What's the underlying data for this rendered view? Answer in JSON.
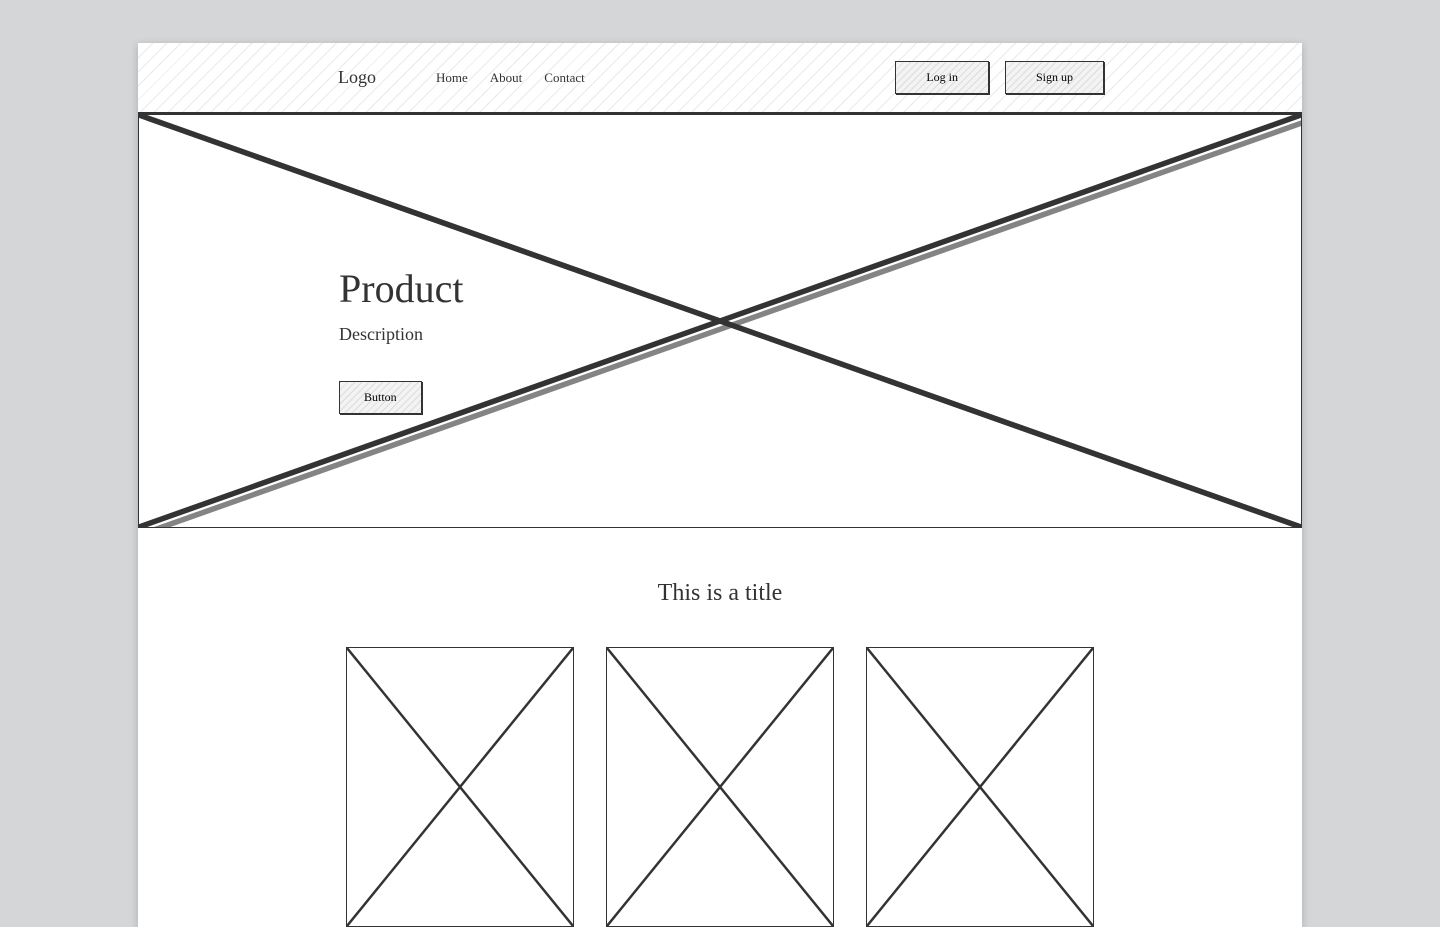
{
  "header": {
    "logo": "Logo",
    "nav": [
      "Home",
      "About",
      "Contact"
    ],
    "login_label": "Log in",
    "signup_label": "Sign up"
  },
  "hero": {
    "title": "Product",
    "description": "Description",
    "button_label": "Button"
  },
  "section": {
    "title": "This is a title"
  }
}
